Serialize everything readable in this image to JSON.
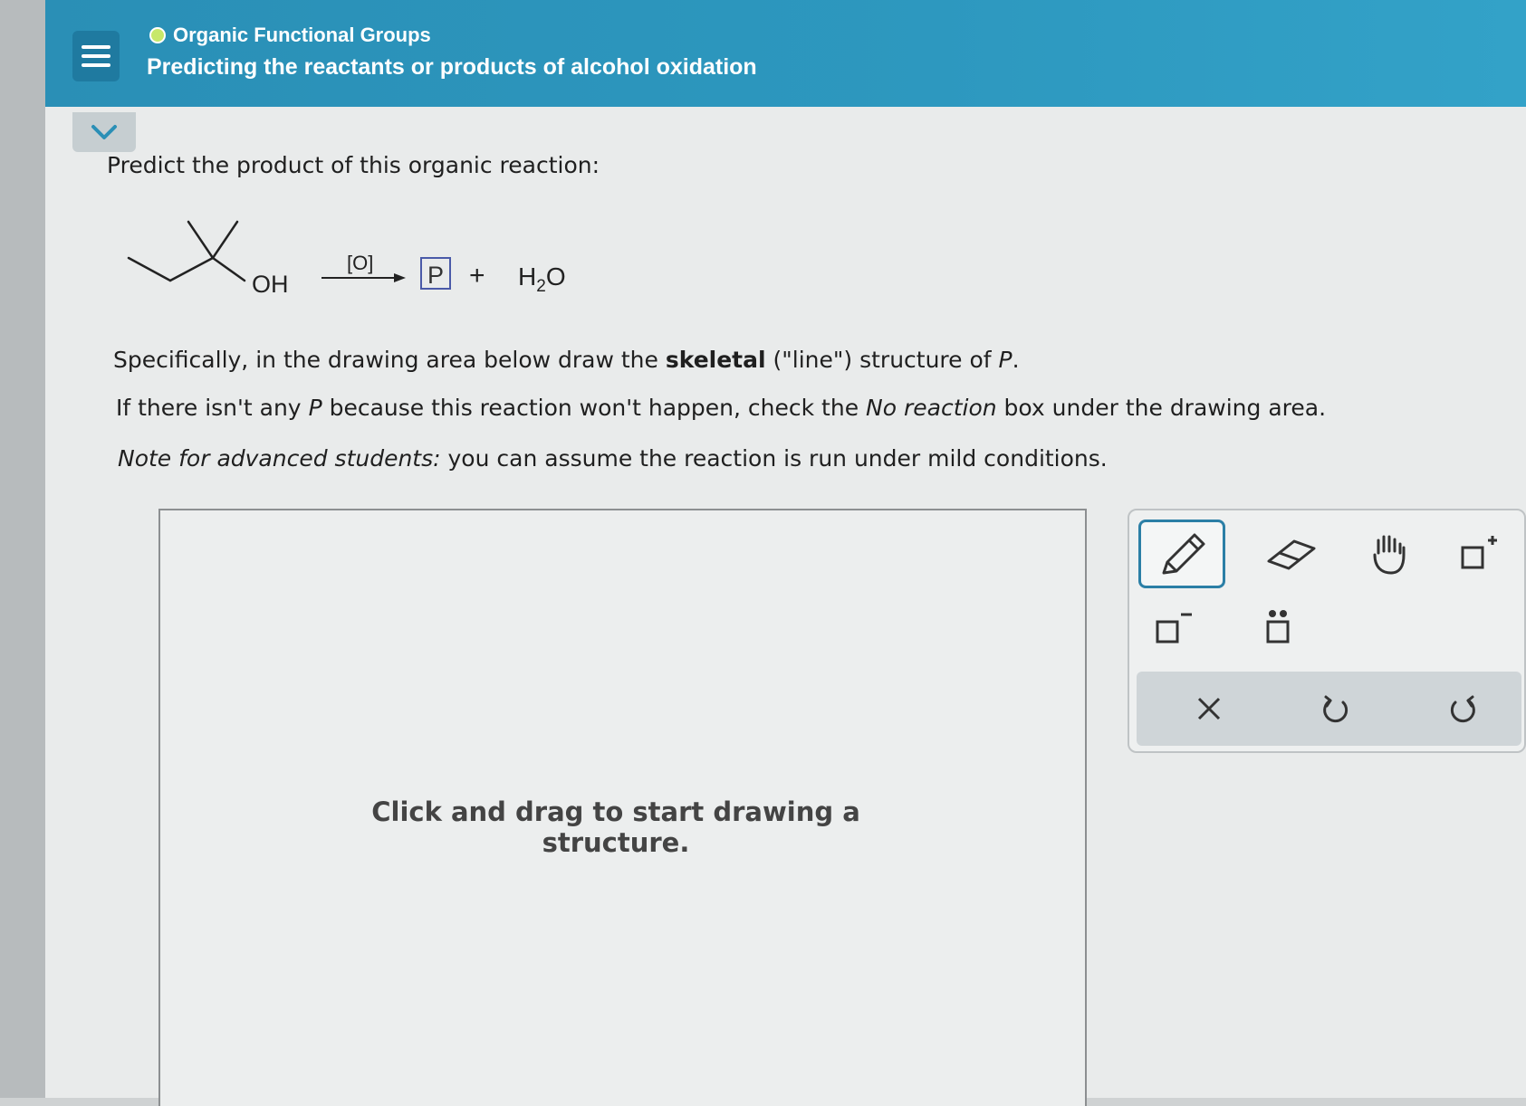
{
  "header": {
    "topic": "Organic Functional Groups",
    "title": "Predicting the reactants or products of alcohol oxidation",
    "status_color": "#c7e86a"
  },
  "question": {
    "prompt": "Predict the product of this organic reaction:",
    "reaction": {
      "reactant_label": "OH",
      "reagent": "[O]",
      "product_box": "P",
      "plus": "+",
      "water_h": "H",
      "water_sub": "2",
      "water_o": "O"
    },
    "line2_a": "Specifically, in the drawing area below draw the ",
    "line2_b": "skeletal",
    "line2_c": " (\"line\") structure of ",
    "line2_d": "P",
    "line2_e": ".",
    "line3_a": "If there isn't any ",
    "line3_b": "P",
    "line3_c": " because this reaction won't happen, check the ",
    "line3_d": "No reaction",
    "line3_e": " box under the drawing area.",
    "line4_a": "Note for advanced students:",
    "line4_b": " you can assume the reaction is run under mild conditions."
  },
  "drawing": {
    "hint": "Click and drag to start drawing a structure."
  },
  "toolbar": {
    "tools": [
      "pencil-icon",
      "eraser-icon",
      "hand-icon",
      "add-positive-charge-icon",
      "add-negative-charge-icon",
      "add-lone-pair-icon"
    ],
    "actions": [
      "clear-icon",
      "undo-icon",
      "redo-icon"
    ],
    "accent": "#2b7fa6"
  }
}
